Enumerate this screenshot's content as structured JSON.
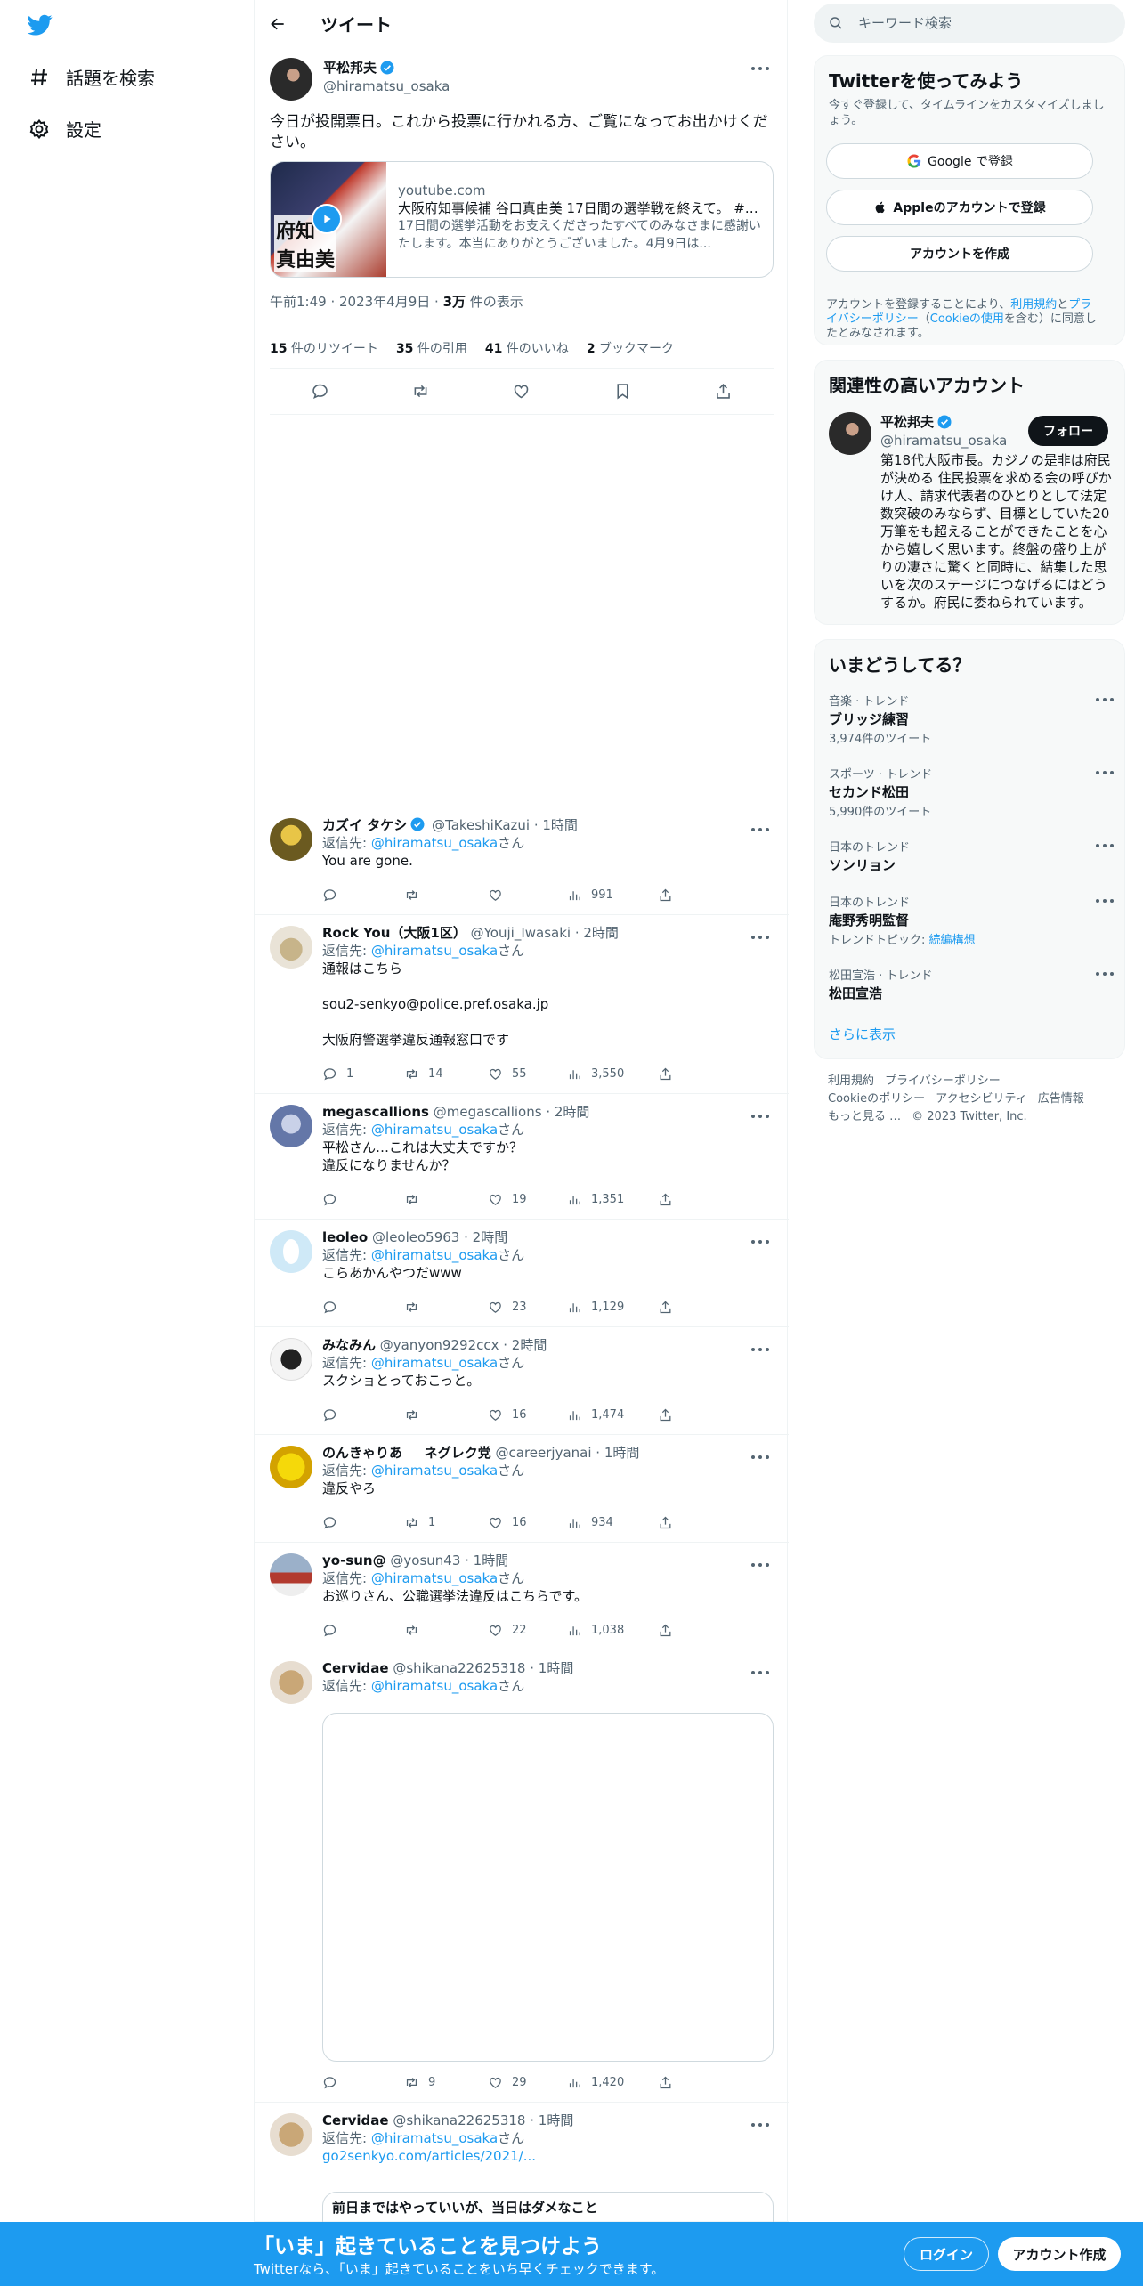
{
  "nav": {
    "explore_label": "話題を検索",
    "settings_label": "設定"
  },
  "header": {
    "title": "ツイート"
  },
  "tweet": {
    "author_name": "平松邦夫",
    "author_handle": "@hiramatsu_osaka",
    "text": "今日が投開票日。これから投票に行かれる方、ご覧になってお出かけください。",
    "card": {
      "thumb_text": "府知\n真由美",
      "domain": "youtube.com",
      "title": "大阪府知事候補 谷口真由美 17日間の選挙戦を終えて。 #大...",
      "description": "17日間の選挙活動をお支えくださったすべてのみなさまに感謝いたします。本当にありがとうございました。4月9日は..."
    },
    "timestamp": "午前1:49 · 2023年4月9日 · ",
    "views_count": "3万",
    "views_label": " 件の表示",
    "stats": [
      {
        "count": "15",
        "label": " 件のリツイート"
      },
      {
        "count": "35",
        "label": " 件の引用"
      },
      {
        "count": "41",
        "label": " 件のいいね"
      },
      {
        "count": "2",
        "label": " ブックマーク"
      }
    ]
  },
  "replies": [
    {
      "name": "カズイ タケシ",
      "verified": true,
      "handle": "@TakeshiKazui",
      "time": " · 1時間",
      "reply_prefix": "返信先: ",
      "reply_to": "@hiramatsu_osaka",
      "reply_suffix": "さん",
      "text": "You are gone.",
      "replies": "",
      "retweets": "",
      "likes": "",
      "views": "991"
    },
    {
      "name": "Rock You（大阪1区）",
      "verified": false,
      "handle": "@Youji_Iwasaki",
      "time": " · 2時間",
      "reply_prefix": "返信先: ",
      "reply_to": "@hiramatsu_osaka",
      "reply_suffix": "さん",
      "text": "通報はこちら\n\nsou2-senkyo@police.pref.osaka.jp\n\n大阪府警選挙違反通報窓口です",
      "replies": "1",
      "retweets": "14",
      "likes": "55",
      "views": "3,550"
    },
    {
      "name": "megascallions",
      "verified": false,
      "handle": "@megascallions",
      "time": " · 2時間",
      "reply_prefix": "返信先: ",
      "reply_to": "@hiramatsu_osaka",
      "reply_suffix": "さん",
      "text": "平松さん…これは大丈夫ですか？\n違反になりませんか？",
      "replies": "",
      "retweets": "",
      "likes": "19",
      "views": "1,351"
    },
    {
      "name": "leoleo",
      "verified": false,
      "handle": "@leoleo5963",
      "time": " · 2時間",
      "reply_prefix": "返信先: ",
      "reply_to": "@hiramatsu_osaka",
      "reply_suffix": "さん",
      "text": "こらあかんやつだwww",
      "replies": "",
      "retweets": "",
      "likes": "23",
      "views": "1,129"
    },
    {
      "name": "みなみん",
      "verified": false,
      "handle": "@yanyon9292ccx",
      "time": " · 2時間",
      "reply_prefix": "返信先: ",
      "reply_to": "@hiramatsu_osaka",
      "reply_suffix": "さん",
      "text": "スクショとっておこっと。",
      "replies": "",
      "retweets": "",
      "likes": "16",
      "views": "1,474"
    },
    {
      "name": "のんきゃりあ     ネグレク党",
      "verified": false,
      "handle": "@careerjyanai",
      "time": " · 1時間",
      "reply_prefix": "返信先: ",
      "reply_to": "@hiramatsu_osaka",
      "reply_suffix": "さん",
      "text": "違反やろ",
      "replies": "",
      "retweets": "1",
      "likes": "16",
      "views": "934"
    },
    {
      "name": "yo-sun@",
      "verified": false,
      "handle": "@yosun43",
      "time": " · 1時間",
      "reply_prefix": "返信先: ",
      "reply_to": "@hiramatsu_osaka",
      "reply_suffix": "さん",
      "text": "お巡りさん、公職選挙法違反はこちらです。",
      "replies": "",
      "retweets": "",
      "likes": "22",
      "views": "1,038"
    },
    {
      "name": "Cervidae",
      "verified": false,
      "handle": "@shikana22625318",
      "time": " · 1時間",
      "reply_prefix": "返信先: ",
      "reply_to": "@hiramatsu_osaka",
      "reply_suffix": "さん",
      "text": "",
      "replies": "",
      "retweets": "9",
      "likes": "29",
      "views": "1,420"
    },
    {
      "name": "Cervidae",
      "verified": false,
      "handle": "@shikana22625318",
      "time": " · 1時間",
      "reply_prefix": "返信先: ",
      "reply_to": "@hiramatsu_osaka",
      "reply_suffix": "さん",
      "text": "",
      "link": "go2senkyo.com/articles/2021/...",
      "card_title": "前日まではやっていいが、当日はダメなこと"
    }
  ],
  "right": {
    "search_placeholder": "キーワード検索",
    "signup_panel": {
      "title": "Twitterを使ってみよう",
      "subtitle": "今すぐ登録して、タイムラインをカスタマイズしましょう。",
      "google_label": "Google で登録",
      "apple_label": "Appleのアカウントで登録",
      "create_label": "アカウントを作成",
      "legal_prefix": "アカウントを登録することにより、",
      "legal_terms": "利用規約",
      "legal_and": "と",
      "legal_privacy": "プライバシーポリシー",
      "legal_paren_open": "（",
      "legal_cookie": "Cookieの使用",
      "legal_paren_close": "を含む）に同意したとみなされます。"
    },
    "related": {
      "title": "関連性の高いアカウント",
      "name": "平松邦夫",
      "handle": "@hiramatsu_osaka",
      "follow_label": "フォロー",
      "bio": "第18代大阪市長。カジノの是非は府民が決める 住民投票を求める会の呼びかけ人、請求代表者のひとりとして法定数突破のみならず、目標としていた20万筆をも超えることができたことを心から嬉しく思います。終盤の盛り上がりの凄さに驚くと同時に、結集した思いを次のステージにつなげるにはどうするか。府民に委ねられています。"
    },
    "trends": {
      "title": "いまどうしてる？",
      "items": [
        {
          "context": "音楽 · トレンド",
          "name": "ブリッジ練習",
          "meta": "3,974件のツイート"
        },
        {
          "context": "スポーツ · トレンド",
          "name": "セカンド松田",
          "meta": "5,990件のツイート"
        },
        {
          "context": "日本のトレンド",
          "name": "ソンリョン",
          "meta": ""
        },
        {
          "context": "日本のトレンド",
          "name": "庵野秀明監督",
          "meta_prefix": "トレンドトピック: ",
          "meta_link": "続編構想"
        },
        {
          "context": "松田宣浩 · トレンド",
          "name": "松田宣浩",
          "meta": ""
        }
      ],
      "more_label": "さらに表示"
    },
    "footer": {
      "terms": "利用規約",
      "privacy": "プライバシーポリシー",
      "cookie": "Cookieのポリシー",
      "accessibility": "アクセシビリティ",
      "ads": "広告情報",
      "more": "もっと見る …",
      "copyright": "© 2023 Twitter, Inc."
    }
  },
  "bottom_bar": {
    "title": "「いま」起きていることを見つけよう",
    "subtitle": "Twitterなら、「いま」起きていることをいち早くチェックできます。",
    "login_label": "ログイン",
    "signup_label": "アカウント作成"
  },
  "colors": {
    "accent": "#1d9bf0",
    "text": "#0f1419",
    "muted": "#536471",
    "border": "#eff3f4"
  }
}
